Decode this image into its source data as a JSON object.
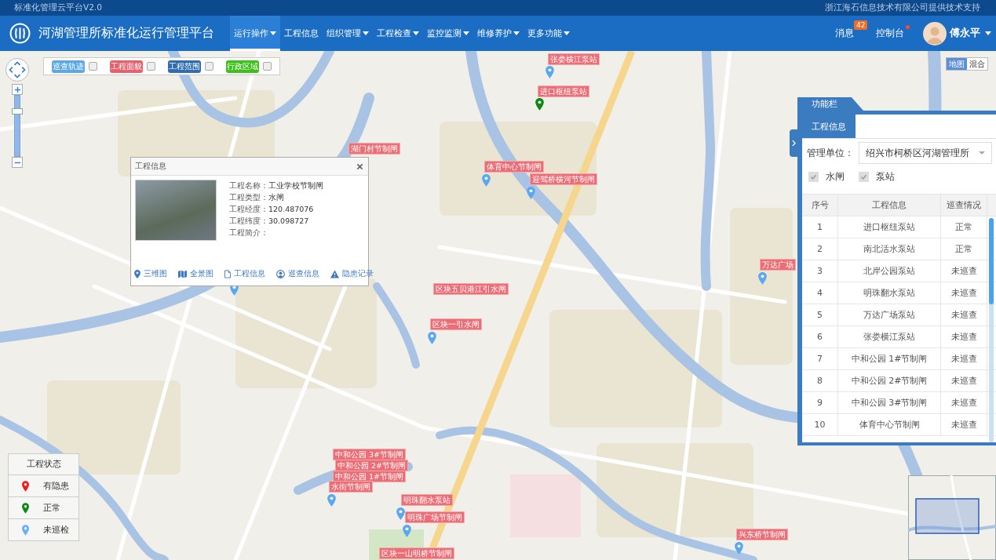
{
  "top_bar": {
    "title": "标准化管理云平台V2.0",
    "notice": "浙江海石信息技术有限公司提供技术支持"
  },
  "header": {
    "title": "河湖管理所标准化运行管理平台",
    "nav": [
      {
        "label": "运行操作",
        "dropdown": true,
        "selected": true
      },
      {
        "label": "工程信息",
        "dropdown": false,
        "selected": false
      },
      {
        "label": "组织管理",
        "dropdown": true,
        "selected": false
      },
      {
        "label": "工程检查",
        "dropdown": true,
        "selected": false
      },
      {
        "label": "监控监测",
        "dropdown": true,
        "selected": false
      },
      {
        "label": "维修养护",
        "dropdown": true,
        "selected": false
      },
      {
        "label": "更多功能",
        "dropdown": true,
        "selected": false
      }
    ],
    "messages": {
      "label": "消息",
      "count": "42"
    },
    "console": {
      "label": "控制台",
      "alert": true
    },
    "user": {
      "name": "傅永平"
    }
  },
  "map": {
    "layers": [
      {
        "label": "巡查轨迹",
        "color": "#5aa8e8",
        "checked": false
      },
      {
        "label": "工程面貌",
        "color": "#e8606c",
        "checked": false
      },
      {
        "label": "工程范围",
        "color": "#2f6db0",
        "checked": false
      },
      {
        "label": "行政区域",
        "color": "#3cc01a",
        "checked": false
      }
    ],
    "zoom": {
      "level": 0.78
    },
    "map_types": [
      {
        "label": "地图",
        "selected": true
      },
      {
        "label": "混合",
        "selected": false
      }
    ],
    "markers": [
      {
        "label": "张娄横江泵站",
        "color": "#5aa8f0"
      },
      {
        "label": "进口枢纽泵站",
        "color": "#0a8a14"
      },
      {
        "label": "湖门村节制闸"
      },
      {
        "label": "体育中心节制闸",
        "color": "#5aa8f0"
      },
      {
        "label": "迎驾桥横河节制闸",
        "color": "#5aa8f0"
      },
      {
        "label": "万达广场",
        "color": "#5aa8f0"
      },
      {
        "label": "区块五贝港江引水闸"
      },
      {
        "label": "区块一引水闸",
        "color": "#5aa8f0"
      },
      {
        "label": "中和公园 3#节制闸"
      },
      {
        "label": "中和公园 2#节制闸"
      },
      {
        "label": "中和公园 1#节制闸"
      },
      {
        "label": "水街节制闸",
        "color": "#5aa8f0"
      },
      {
        "label": "明珠翻水泵站",
        "color": "#5aa8f0"
      },
      {
        "label": "明珠广场节制闸",
        "color": "#5aa8f0"
      },
      {
        "label": "区块一山明桥节制闸"
      },
      {
        "label": "兴东桥节制闸",
        "color": "#5aa8f0"
      },
      {
        "color": "#5aa8f0"
      }
    ],
    "popup": {
      "title": "工程信息",
      "fields": [
        {
          "label": "工程名称：",
          "value": "工业学校节制闸"
        },
        {
          "label": "工程类型：",
          "value": "水闸"
        },
        {
          "label": "工程经度：",
          "value": "120.487076"
        },
        {
          "label": "工程纬度：",
          "value": "30.098727"
        },
        {
          "label": "工程简介："
        }
      ],
      "actions": [
        {
          "label": "三维图",
          "kind": "pin"
        },
        {
          "label": "全景图",
          "kind": "map"
        },
        {
          "label": "工程信息",
          "kind": "file"
        },
        {
          "label": "巡查信息",
          "kind": "user"
        },
        {
          "label": "隐患记录",
          "kind": "warning"
        }
      ]
    },
    "legend": {
      "title": "工程状态",
      "items": [
        {
          "label": "有隐患",
          "color": "#f01c1c"
        },
        {
          "label": "正常",
          "color": "#0a8a14"
        },
        {
          "label": "未巡检",
          "color": "#6ab0f5"
        }
      ]
    }
  },
  "panel": {
    "title": "功能栏",
    "tabs": [
      {
        "label": "工程信息",
        "selected": true
      }
    ],
    "unit": {
      "label": "管理单位：",
      "value": "绍兴市柯桥区河湖管理所"
    },
    "filters": [
      {
        "label": "水闸",
        "checked": true
      },
      {
        "label": "泵站",
        "checked": true
      }
    ],
    "table": {
      "columns": [
        "序号",
        "工程信息",
        "巡查情况"
      ],
      "rows": [
        [
          "1",
          "进口枢纽泵站",
          "正常"
        ],
        [
          "2",
          "南北活水泵站",
          "正常"
        ],
        [
          "3",
          "北岸公园泵站",
          "未巡查"
        ],
        [
          "4",
          "明珠翻水泵站",
          "未巡查"
        ],
        [
          "5",
          "万达广场泵站",
          "未巡查"
        ],
        [
          "6",
          "张娄横江泵站",
          "未巡查"
        ],
        [
          "7",
          "中和公园 1#节制闸",
          "未巡查"
        ],
        [
          "8",
          "中和公园 2#节制闸",
          "未巡查"
        ],
        [
          "9",
          "中和公园 3#节制闸",
          "未巡查"
        ],
        [
          "10",
          "体育中心节制闸",
          "未巡查"
        ]
      ]
    }
  }
}
